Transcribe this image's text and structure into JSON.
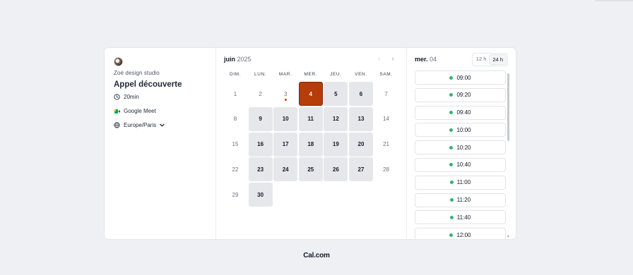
{
  "profile": {
    "owner_name": "Zoé design studio",
    "event_title": "Appel découverte",
    "duration": "20min",
    "location": "Google Meet",
    "timezone": "Europe/Paris"
  },
  "icons": {
    "avatar": "avatar",
    "duration": "clock-icon",
    "location": "google-meet-icon",
    "timezone": "globe-icon",
    "timezone_toggle": "chevron-down-icon",
    "prev": "chevron-left-icon",
    "next": "chevron-right-icon"
  },
  "calendar": {
    "month": "juin",
    "year": "2025",
    "prev_label": "‹",
    "next_label": "›",
    "weekdays": [
      "DIM.",
      "LUN.",
      "MAR.",
      "MER.",
      "JEU.",
      "VEN.",
      "SAM."
    ],
    "weeks": [
      [
        "1",
        "2",
        "3",
        "4",
        "5",
        "6",
        "7"
      ],
      [
        "8",
        "9",
        "10",
        "11",
        "12",
        "13",
        "14"
      ],
      [
        "15",
        "16",
        "17",
        "18",
        "19",
        "20",
        "21"
      ],
      [
        "22",
        "23",
        "24",
        "25",
        "26",
        "27",
        "28"
      ],
      [
        "29",
        "30",
        "",
        "",
        "",
        "",
        ""
      ]
    ],
    "available_days": [
      "4",
      "5",
      "6",
      "9",
      "10",
      "11",
      "12",
      "13",
      "16",
      "17",
      "18",
      "19",
      "20",
      "23",
      "24",
      "25",
      "26",
      "27",
      "30"
    ],
    "selected_day": "4",
    "today": "3"
  },
  "times": {
    "selected_date_weekday": "mer.",
    "selected_date_day": "04",
    "format_12h": "12 h",
    "format_24h": "24 h",
    "active_format": "24 h",
    "slots": [
      "09:00",
      "09:20",
      "09:40",
      "10:00",
      "10:20",
      "10:40",
      "11:00",
      "11:20",
      "11:40",
      "12:00"
    ]
  },
  "colors": {
    "selected_day": "#b63c0a",
    "available_day": "#e5e7eb",
    "slot_dot": "#34b277",
    "background": "#eef0f3"
  },
  "footer": {
    "brand": "Cal.com"
  }
}
